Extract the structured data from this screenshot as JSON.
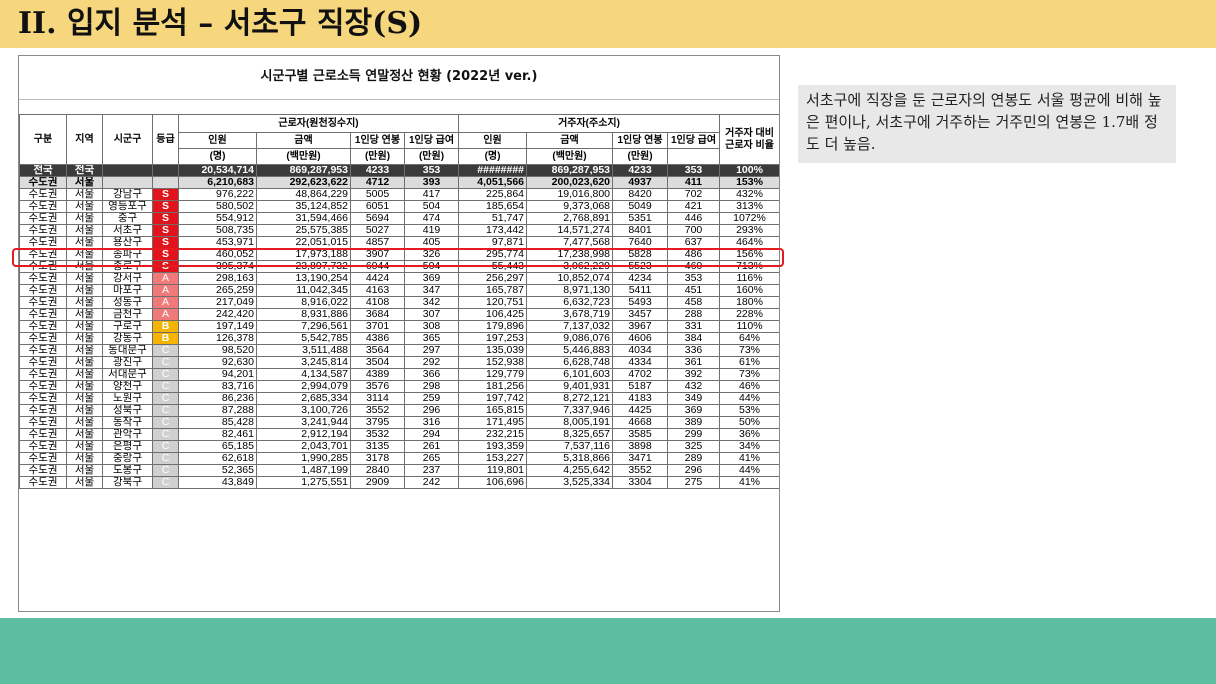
{
  "slide": {
    "title": "II. 입지 분석 – 서초구 직장(S)"
  },
  "table": {
    "caption": "시군구별 근로소득 연말정산 현황 (2022년 ver.)",
    "headers": {
      "gubun": "구분",
      "region": "지역",
      "sigungu": "시군구",
      "grade": "등급",
      "worker_group": "근로자(원천징수지)",
      "resident_group": "거주자(주소지)",
      "ratio_top": "거주자 대비",
      "ratio_bottom": "근로자 비율",
      "w_people": "인원",
      "w_people_unit": "(명)",
      "w_amount": "금액",
      "w_amount_unit": "(백만원)",
      "w_per_salary": "1인당 연봉",
      "w_per_salary_unit": "(만원)",
      "w_per_pay": "1인당 급여",
      "w_per_pay_unit": "(만원)",
      "r_people": "인원",
      "r_people_unit": "(명)",
      "r_amount": "금액",
      "r_amount_unit": "(백만원)",
      "r_per_salary": "1인당 연봉",
      "r_per_salary_unit": "(만원)",
      "r_per_pay": "1인당 급여",
      "r_per_pay_unit": ""
    },
    "rows": [
      [
        "전국",
        "전국",
        "",
        "",
        "20,534,714",
        "869,287,953",
        "4233",
        "353",
        "########",
        "869,287,953",
        "4233",
        "353",
        "100%"
      ],
      [
        "수도권",
        "서울",
        "",
        "",
        "6,210,683",
        "292,623,622",
        "4712",
        "393",
        "4,051,566",
        "200,023,620",
        "4937",
        "411",
        "153%"
      ],
      [
        "수도권",
        "서울",
        "강남구",
        "S",
        "976,222",
        "48,864,229",
        "5005",
        "417",
        "225,864",
        "19,016,800",
        "8420",
        "702",
        "432%"
      ],
      [
        "수도권",
        "서울",
        "영등포구",
        "S",
        "580,502",
        "35,124,852",
        "6051",
        "504",
        "185,654",
        "9,373,068",
        "5049",
        "421",
        "313%"
      ],
      [
        "수도권",
        "서울",
        "중구",
        "S",
        "554,912",
        "31,594,466",
        "5694",
        "474",
        "51,747",
        "2,768,891",
        "5351",
        "446",
        "1072%"
      ],
      [
        "수도권",
        "서울",
        "서초구",
        "S",
        "508,735",
        "25,575,385",
        "5027",
        "419",
        "173,442",
        "14,571,274",
        "8401",
        "700",
        "293%"
      ],
      [
        "수도권",
        "서울",
        "용산구",
        "S",
        "453,971",
        "22,051,015",
        "4857",
        "405",
        "97,871",
        "7,477,568",
        "7640",
        "637",
        "464%"
      ],
      [
        "수도권",
        "서울",
        "송파구",
        "S",
        "460,052",
        "17,973,188",
        "3907",
        "326",
        "295,774",
        "17,238,998",
        "5828",
        "486",
        "156%"
      ],
      [
        "수도권",
        "서울",
        "종로구",
        "S",
        "395,374",
        "23,897,732",
        "6044",
        "504",
        "55,443",
        "3,062,229",
        "5523",
        "460",
        "713%"
      ],
      [
        "수도권",
        "서울",
        "강서구",
        "A",
        "298,163",
        "13,190,254",
        "4424",
        "369",
        "256,297",
        "10,852,074",
        "4234",
        "353",
        "116%"
      ],
      [
        "수도권",
        "서울",
        "마포구",
        "A",
        "265,259",
        "11,042,345",
        "4163",
        "347",
        "165,787",
        "8,971,130",
        "5411",
        "451",
        "160%"
      ],
      [
        "수도권",
        "서울",
        "성동구",
        "A",
        "217,049",
        "8,916,022",
        "4108",
        "342",
        "120,751",
        "6,632,723",
        "5493",
        "458",
        "180%"
      ],
      [
        "수도권",
        "서울",
        "금천구",
        "A",
        "242,420",
        "8,931,886",
        "3684",
        "307",
        "106,425",
        "3,678,719",
        "3457",
        "288",
        "228%"
      ],
      [
        "수도권",
        "서울",
        "구로구",
        "B",
        "197,149",
        "7,296,561",
        "3701",
        "308",
        "179,896",
        "7,137,032",
        "3967",
        "331",
        "110%"
      ],
      [
        "수도권",
        "서울",
        "강동구",
        "B",
        "126,378",
        "5,542,785",
        "4386",
        "365",
        "197,253",
        "9,086,076",
        "4606",
        "384",
        "64%"
      ],
      [
        "수도권",
        "서울",
        "동대문구",
        "C",
        "98,520",
        "3,511,488",
        "3564",
        "297",
        "135,039",
        "5,446,883",
        "4034",
        "336",
        "73%"
      ],
      [
        "수도권",
        "서울",
        "광진구",
        "C",
        "92,630",
        "3,245,814",
        "3504",
        "292",
        "152,938",
        "6,628,748",
        "4334",
        "361",
        "61%"
      ],
      [
        "수도권",
        "서울",
        "서대문구",
        "C",
        "94,201",
        "4,134,587",
        "4389",
        "366",
        "129,779",
        "6,101,603",
        "4702",
        "392",
        "73%"
      ],
      [
        "수도권",
        "서울",
        "양천구",
        "C",
        "83,716",
        "2,994,079",
        "3576",
        "298",
        "181,256",
        "9,401,931",
        "5187",
        "432",
        "46%"
      ],
      [
        "수도권",
        "서울",
        "노원구",
        "C",
        "86,236",
        "2,685,334",
        "3114",
        "259",
        "197,742",
        "8,272,121",
        "4183",
        "349",
        "44%"
      ],
      [
        "수도권",
        "서울",
        "성북구",
        "C",
        "87,288",
        "3,100,726",
        "3552",
        "296",
        "165,815",
        "7,337,946",
        "4425",
        "369",
        "53%"
      ],
      [
        "수도권",
        "서울",
        "동작구",
        "C",
        "85,428",
        "3,241,944",
        "3795",
        "316",
        "171,495",
        "8,005,191",
        "4668",
        "389",
        "50%"
      ],
      [
        "수도권",
        "서울",
        "관악구",
        "C",
        "82,461",
        "2,912,194",
        "3532",
        "294",
        "232,215",
        "8,325,657",
        "3585",
        "299",
        "36%"
      ],
      [
        "수도권",
        "서울",
        "은평구",
        "C",
        "65,185",
        "2,043,701",
        "3135",
        "261",
        "193,359",
        "7,537,116",
        "3898",
        "325",
        "34%"
      ],
      [
        "수도권",
        "서울",
        "중랑구",
        "C",
        "62,618",
        "1,990,285",
        "3178",
        "265",
        "153,227",
        "5,318,866",
        "3471",
        "289",
        "41%"
      ],
      [
        "수도권",
        "서울",
        "도봉구",
        "C",
        "52,365",
        "1,487,199",
        "2840",
        "237",
        "119,801",
        "4,255,642",
        "3552",
        "296",
        "44%"
      ],
      [
        "수도권",
        "서울",
        "강북구",
        "C",
        "43,849",
        "1,275,551",
        "2909",
        "242",
        "106,696",
        "3,525,334",
        "3304",
        "275",
        "41%"
      ]
    ]
  },
  "note": {
    "text": "서초구에 직장을 둔 근로자의 연봉도 서울 평균에 비해 높은 편이나, 서초구에 거주하는 거주민의 연봉은 1.7배 정도 더 높음."
  },
  "colors": {
    "title_bg": "#f6d77e",
    "bottom_band": "#5bbf9f",
    "grade_S": "#e0141a",
    "grade_A": "#f07a7a",
    "grade_B": "#f4b400",
    "grade_C": "#d0d0d0",
    "highlight": "#e41c22"
  }
}
